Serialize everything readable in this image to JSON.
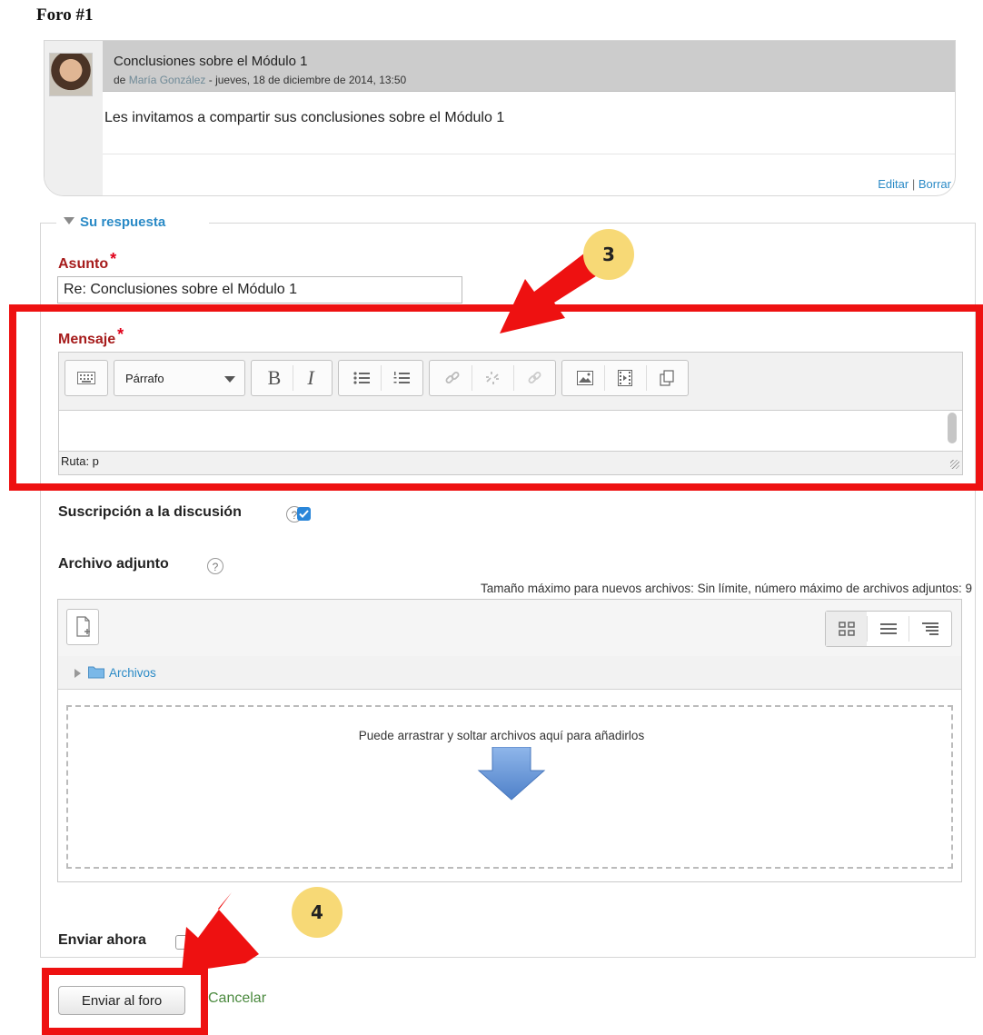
{
  "page": {
    "title": "Foro #1"
  },
  "post": {
    "subject": "Conclusiones sobre el Módulo 1",
    "by_prefix": "de",
    "author": "María González",
    "date": "- jueves, 18 de diciembre de 2014, 13:50",
    "message": "Les invitamos a compartir sus conclusiones sobre el Módulo 1",
    "edit_label": "Editar",
    "separator": "|",
    "delete_label": "Borrar"
  },
  "form": {
    "legend": "Su respuesta",
    "subject_label": "Asunto",
    "required_mark": "*",
    "subject_value": "Re: Conclusiones sobre el Módulo 1",
    "message_label": "Mensaje",
    "editor": {
      "format_value": "Párrafo",
      "bold_label": "B",
      "italic_label": "I",
      "path_text": "Ruta: p"
    },
    "subscribe_label": "Suscripción a la discusión",
    "subscribe_checked": true,
    "attach_label": "Archivo adjunto",
    "attach_info": "Tamaño máximo para nuevos archivos: Sin límite, número máximo de archivos adjuntos: 9",
    "folder_label": "Archivos",
    "drop_text": "Puede arrastrar y soltar archivos aquí para añadirlos",
    "sendnow_label": "Enviar ahora",
    "sendnow_checked": false,
    "submit_label": "Enviar al foro",
    "cancel_label": "Cancelar",
    "help_glyph": "?"
  },
  "annotations": {
    "step3": "3",
    "step4": "4"
  },
  "colors": {
    "accent": "#2a8ac6",
    "annotation_red": "#ee1111",
    "badge_yellow": "#f7d976",
    "required_red": "#a61b1b"
  }
}
